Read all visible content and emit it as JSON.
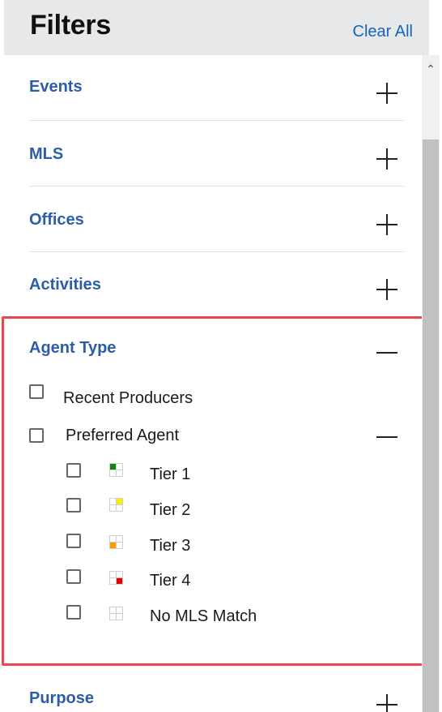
{
  "header": {
    "title": "Filters",
    "clear_all": "Clear All"
  },
  "sections_top": [
    {
      "label": "Events",
      "state": "collapsed"
    },
    {
      "label": "MLS",
      "state": "collapsed"
    },
    {
      "label": "Offices",
      "state": "collapsed"
    },
    {
      "label": "Activities",
      "state": "collapsed"
    }
  ],
  "agent_type": {
    "label": "Agent Type",
    "state": "expanded",
    "options": [
      {
        "label": "Recent Producers",
        "checked": false
      },
      {
        "label": "Preferred Agent",
        "checked": false,
        "state": "expanded"
      }
    ],
    "tiers": [
      {
        "label": "Tier 1",
        "checked": false,
        "color": "#0a8a0a",
        "quadrant": "top-left"
      },
      {
        "label": "Tier 2",
        "checked": false,
        "color": "#ffee00",
        "quadrant": "top-right"
      },
      {
        "label": "Tier 3",
        "checked": false,
        "color": "#ff9900",
        "quadrant": "bottom-left"
      },
      {
        "label": "Tier 4",
        "checked": false,
        "color": "#e60000",
        "quadrant": "bottom-right"
      },
      {
        "label": "No MLS Match",
        "checked": false,
        "color": "",
        "quadrant": "none"
      }
    ]
  },
  "sections_bottom": [
    {
      "label": "Purpose",
      "state": "collapsed"
    }
  ],
  "colors": {
    "accent_blue": "#2d5da8",
    "link_blue": "#1565c0",
    "highlight_red": "#e8474e"
  }
}
